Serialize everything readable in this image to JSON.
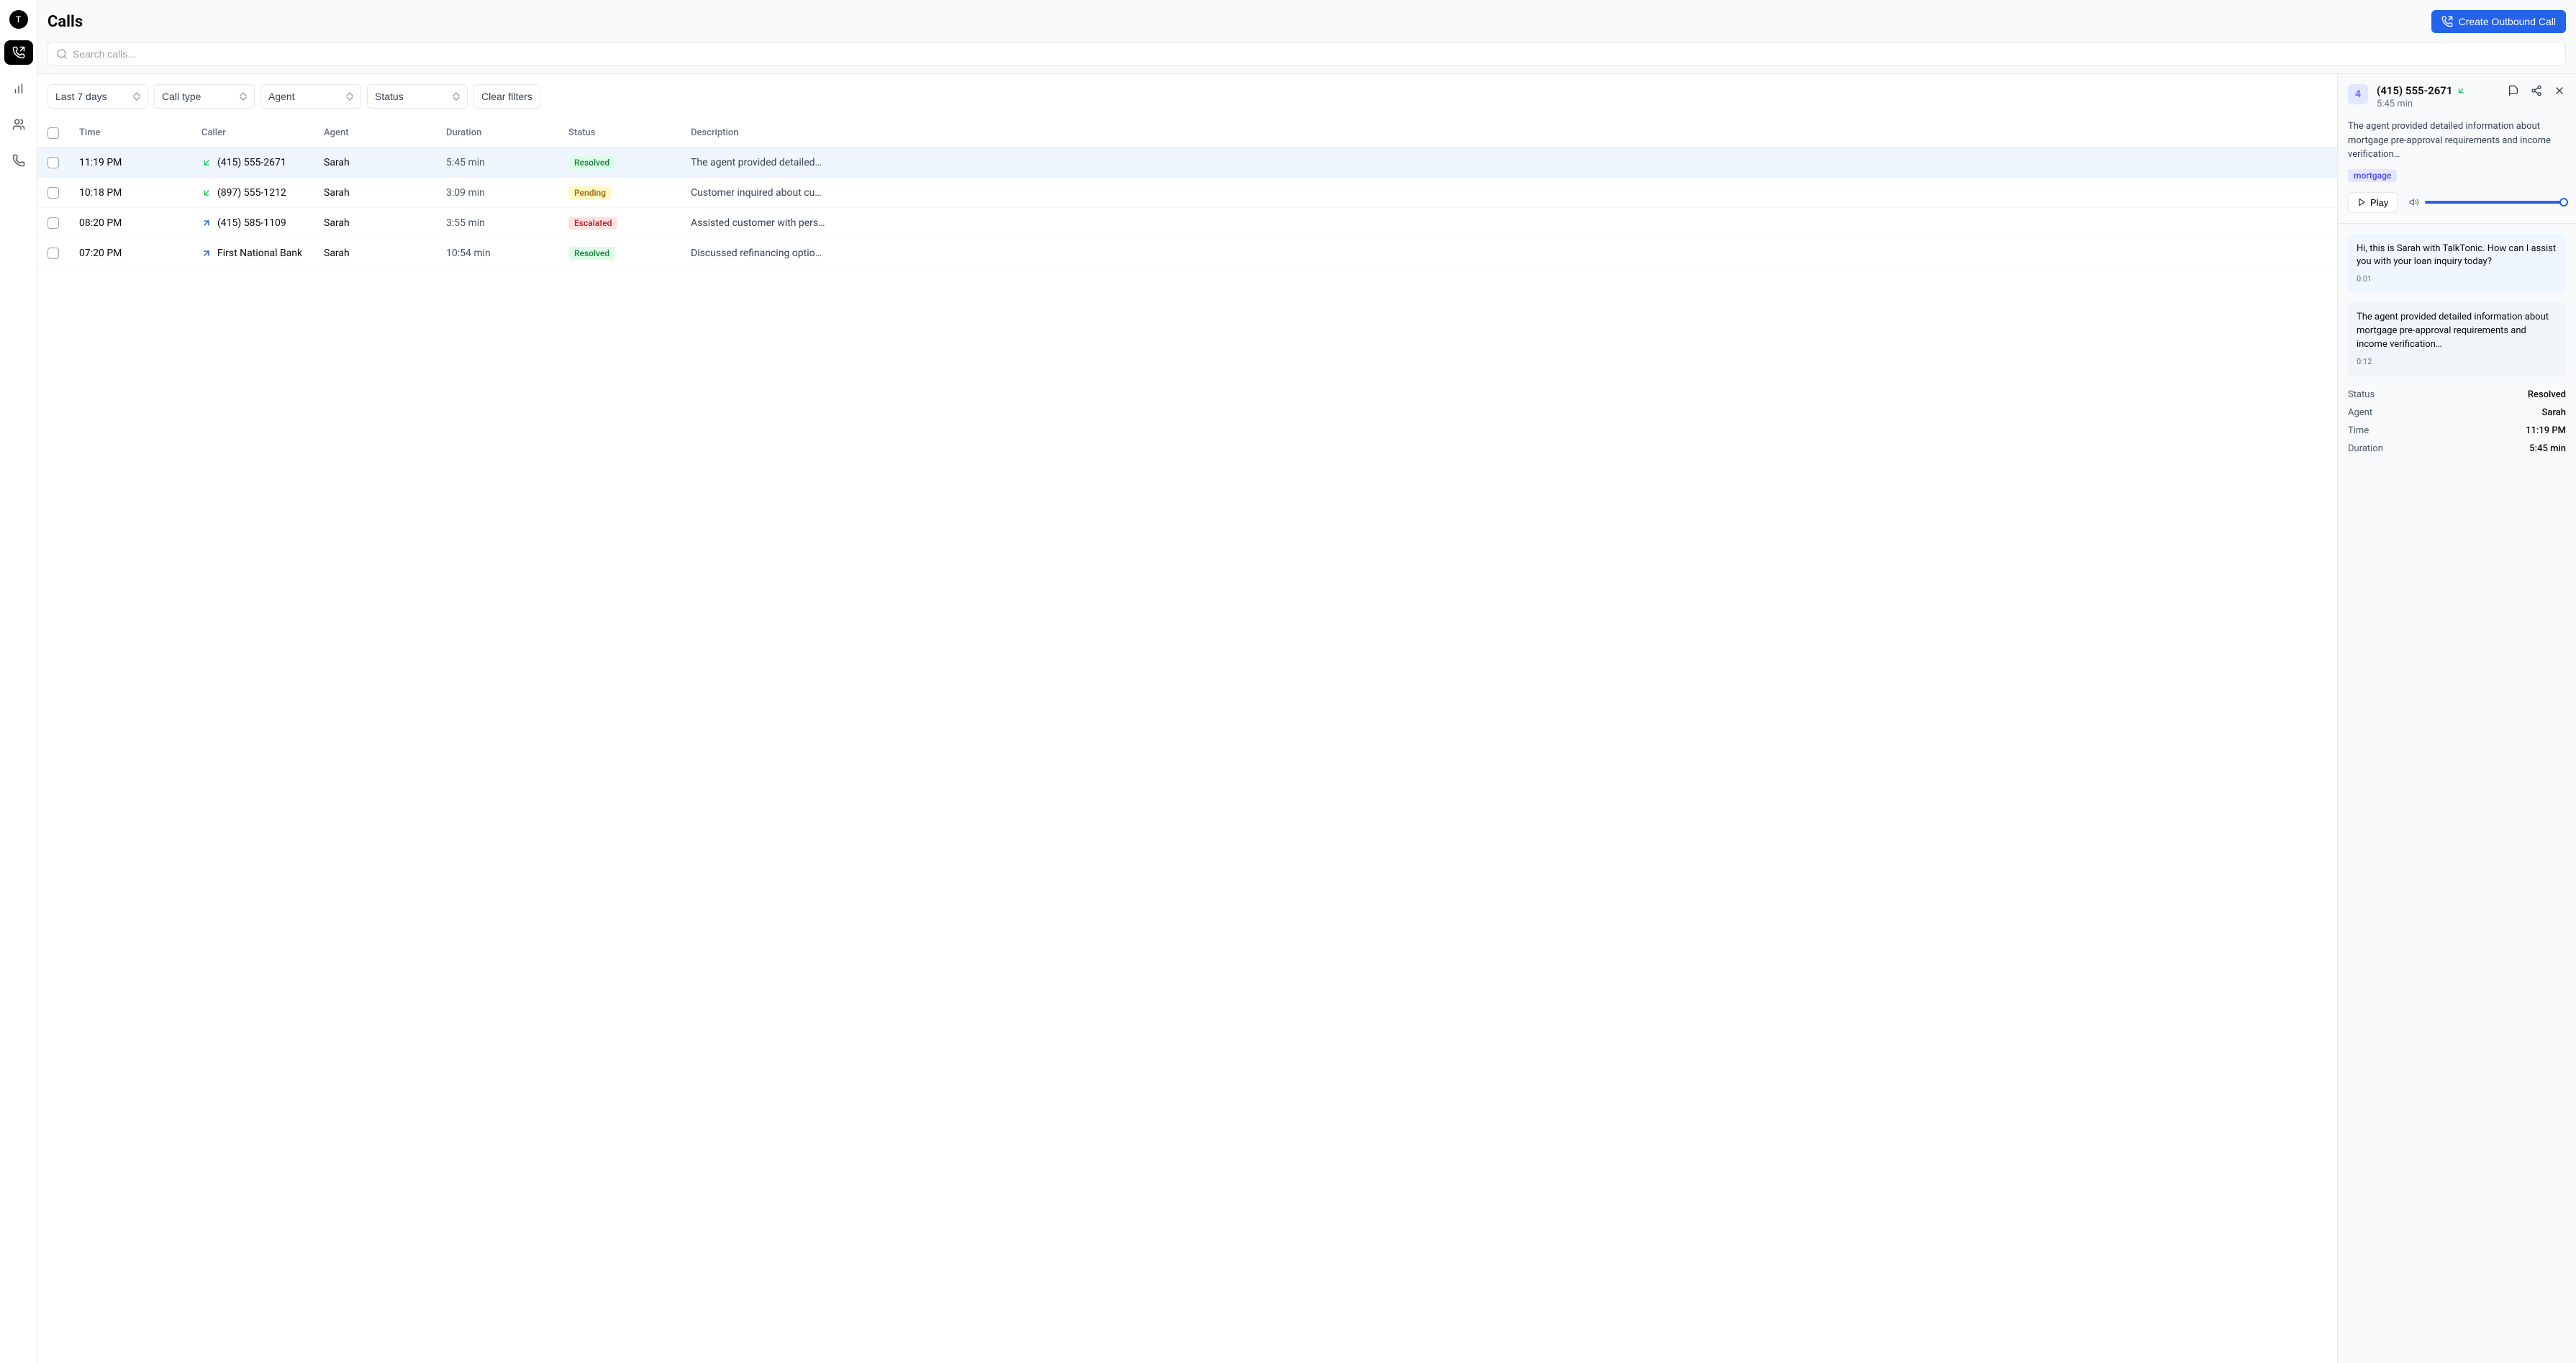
{
  "nav": {
    "avatar_initial": "T"
  },
  "header": {
    "title": "Calls",
    "create_button": "Create Outbound Call",
    "search_placeholder": "Search calls..."
  },
  "filters": {
    "time_range": "Last 7 days",
    "call_type": "Call type",
    "agent": "Agent",
    "status": "Status",
    "clear": "Clear filters"
  },
  "columns": {
    "time": "Time",
    "caller": "Caller",
    "agent": "Agent",
    "duration": "Duration",
    "status": "Status",
    "description": "Description"
  },
  "calls": [
    {
      "time": "11:19 PM",
      "direction": "in",
      "caller": "(415) 555-2671",
      "agent": "Sarah",
      "duration": "5:45 min",
      "status": "Resolved",
      "status_class": "resolved",
      "description": "The agent provided detailed…",
      "selected": true
    },
    {
      "time": "10:18 PM",
      "direction": "in",
      "caller": "(897) 555-1212",
      "agent": "Sarah",
      "duration": "3:09 min",
      "status": "Pending",
      "status_class": "pending",
      "description": "Customer inquired about cu…",
      "selected": false
    },
    {
      "time": "08:20 PM",
      "direction": "out",
      "caller": "(415) 585-1109",
      "agent": "Sarah",
      "duration": "3:55 min",
      "status": "Escalated",
      "status_class": "escalated",
      "description": "Assisted customer with pers…",
      "selected": false
    },
    {
      "time": "07:20 PM",
      "direction": "out",
      "caller": "First National Bank",
      "agent": "Sarah",
      "duration": "10:54 min",
      "status": "Resolved",
      "status_class": "resolved",
      "description": "Discussed refinancing optio…",
      "selected": false
    }
  ],
  "detail": {
    "avatar_char": "4",
    "title": "(415) 555-2671",
    "direction": "in",
    "duration": "5:45 min",
    "summary": "The agent provided detailed information about mortgage pre-approval requirements and income verification…",
    "tag": "mortgage",
    "play_label": "Play",
    "transcript": [
      {
        "role": "agent",
        "text": "Hi, this is Sarah with TalkTonic. How can I assist you with your loan inquiry today?",
        "time": "0:01"
      },
      {
        "role": "system",
        "text": "The agent provided detailed information about mortgage pre-approval requirements and income verification…",
        "time": "0:12"
      }
    ],
    "meta": {
      "status_label": "Status",
      "status_value": "Resolved",
      "agent_label": "Agent",
      "agent_value": "Sarah",
      "time_label": "Time",
      "time_value": "11:19 PM",
      "duration_label": "Duration",
      "duration_value": "5:45 min"
    }
  }
}
